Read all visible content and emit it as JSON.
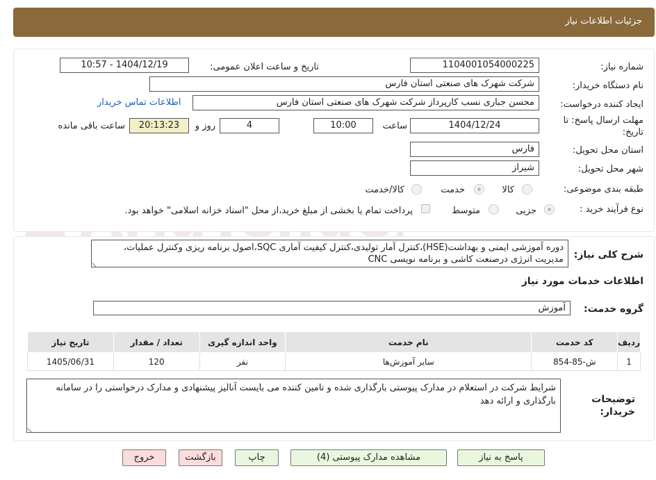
{
  "header": {
    "title": "جزئیات اطلاعات نیاز"
  },
  "watermark": {
    "text": "AriaTender.neT"
  },
  "form": {
    "need_number_label": "شماره نیاز:",
    "need_number": "1104001054000225",
    "announce_label": "تاریخ و ساعت اعلان عمومی:",
    "announce_value": "1404/12/19 - 10:57",
    "buyer_org_label": "نام دستگاه خریدار:",
    "buyer_org": "شرکت شهرک های صنعتی استان فارس",
    "requester_label": "ایجاد کننده درخواست:",
    "requester": "محسن  جباری نسب کارپرداز شرکت شهرک های صنعتی استان فارس",
    "contact_link": "اطلاعات تماس خریدار",
    "deadline_label_1": "مهلت ارسال پاسخ: تا",
    "deadline_label_2": "تاریخ:",
    "deadline_date": "1404/12/24",
    "time_label": "ساعت",
    "deadline_time": "10:00",
    "days": "4",
    "days_label": "روز و",
    "remaining": "20:13:23",
    "remaining_label": "ساعت باقی مانده",
    "province_label": "استان محل تحویل:",
    "province": "فارس",
    "city_label": "شهر محل تحویل:",
    "city": "شیراز",
    "category_label": "طبقه بندی موضوعی:",
    "category_options": [
      "کالا",
      "خدمت",
      "کالا/خدمت"
    ],
    "process_label": "نوع فرآیند خرید :",
    "process_options": [
      "جزیی",
      "متوسط"
    ],
    "payment_note": "پرداخت تمام یا بخشی از مبلغ خرید،از محل \"اسناد خزانه اسلامی\" خواهد بود."
  },
  "description": {
    "label": "شرح کلی نیاز:",
    "text": "دوره آموزشی ایمنی و بهداشت(HSE)،کنترل آمار تولیدی،کنترل کیفیت آماری SQC،اصول برنامه ریزی وکنترل عملیات، مدیریت انرژی درصنعت کاشی و برنامه نویسی CNC"
  },
  "services": {
    "title": "اطلاعات خدمات مورد نیاز",
    "group_label": "گروه خدمت:",
    "group_value": "آموزش",
    "columns": [
      "ردیف",
      "کد خدمت",
      "نام خدمت",
      "واحد اندازه گیری",
      "تعداد / مقدار",
      "تاریخ نیاز"
    ],
    "rows": [
      {
        "row": "1",
        "code": "ش-85-854",
        "name": "سایر آموزش‌ها",
        "unit": "نفر",
        "qty": "120",
        "date": "1405/06/31"
      }
    ]
  },
  "buyer_notes": {
    "label_1": "توضیحات",
    "label_2": "خریدار:",
    "text": "شرایط شرکت در استعلام در مدارک پیوستی بارگذاری شده و تامین کننده می بایست آنالیز پیشنهادی و مدارک درخواستی را در سامانه بارگذاری و ارائه دهد"
  },
  "buttons": {
    "reply": "پاسخ به نیاز",
    "attachments": "مشاهده مدارک پیوستی (4)",
    "print": "چاپ",
    "back": "بازگشت",
    "exit": "خروج"
  },
  "colors": {
    "header": "#8a6a3a",
    "green_button": "#e9f7de",
    "pink_button": "#fbdcdc",
    "link": "#1a5fb4"
  }
}
